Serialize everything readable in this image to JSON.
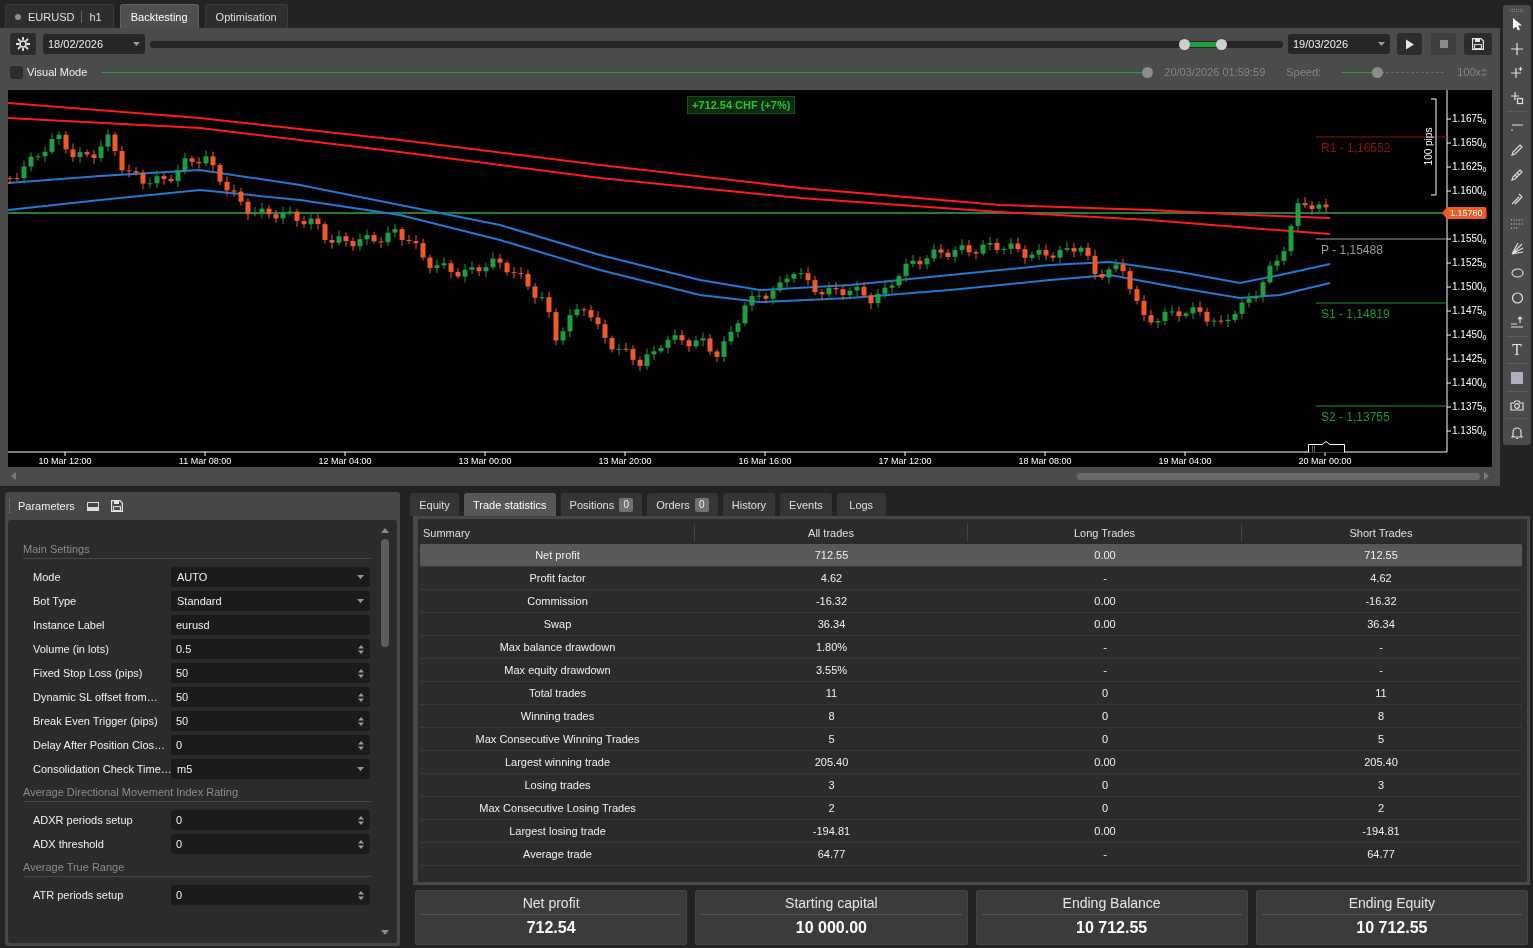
{
  "workspace_tabs": [
    {
      "kind": "symbol",
      "label": "EURUSD",
      "timeframe": "h1",
      "selected": false
    },
    {
      "kind": "mode",
      "label": "Backtesting",
      "selected": true
    },
    {
      "kind": "mode",
      "label": "Optimisation",
      "selected": false
    }
  ],
  "backtest_controls": {
    "start_date": "18/02/2026",
    "period_handles": [
      {
        "level": 0.913
      },
      {
        "level": 0.945
      }
    ],
    "end_date": "19/03/2026",
    "buttons": [
      {
        "kind": "play",
        "disabled": false
      },
      {
        "kind": "stop",
        "disabled": true
      },
      {
        "kind": "save",
        "disabled": false
      }
    ],
    "visual_mode": {
      "label": "Visual Mode",
      "checked": false
    },
    "progress": {
      "level": 1
    },
    "timestamp": "20/03/2026 01:59:59",
    "speed": {
      "label": "Speed:",
      "level": 0.33,
      "value": "100x"
    }
  },
  "chart": {
    "profit_badge": "+712.54 CHF (+7%)",
    "ruler_label": "100 pips",
    "price_labels": [
      "1.1675$_{0}$",
      "1.1650$_{0}$",
      "1.1625$_{0}$",
      "1.1600$_{0}$",
      "1.1550$_{0}$",
      "1.1525$_{0}$",
      "1.1500$_{0}$",
      "1.1475$_{0}$",
      "1.1450$_{0}$",
      "1.1425$_{0}$",
      "1.1400$_{0}$",
      "1.1375$_{0}$",
      "1.1350$_{0}$"
    ],
    "current_price": "1.15760",
    "pivots": [
      {
        "label": "R1 - 1,16552",
        "color": "#8b1414"
      },
      {
        "label": "P - 1,15488",
        "color": "#9a9a9a"
      },
      {
        "label": "S1 - 1,14819",
        "color": "#1d9a24"
      },
      {
        "label": "S2 - 1,13755",
        "color": "#1d9a24"
      }
    ],
    "time_labels": [
      "10 Mar 12:00",
      "11 Mar 08:00",
      "12 Mar 04:00",
      "13 Mar 00:00",
      "13 Mar 20:00",
      "16 Mar 16:00",
      "17 Mar 12:00",
      "18 Mar 08:00",
      "19 Mar 04:00",
      "20 Mar 00:00"
    ]
  },
  "drawing_toolbar": {
    "text_tool_label": "T"
  },
  "parameters": {
    "title": "Parameters",
    "groups": [
      {
        "title": "Main Settings",
        "rows": [
          {
            "label": "Mode",
            "kind": "select",
            "value": "AUTO"
          },
          {
            "label": "Bot Type",
            "kind": "select",
            "value": "Standard"
          },
          {
            "label": "Instance Label",
            "kind": "text",
            "value": "eurusd"
          },
          {
            "label": "Volume (in lots)",
            "kind": "number",
            "value": "0.5"
          },
          {
            "label": "Fixed Stop Loss (pips)",
            "kind": "number",
            "value": "50"
          },
          {
            "label": "Dynamic SL offset from…",
            "kind": "number",
            "value": "50"
          },
          {
            "label": "Break Even Trigger (pips)",
            "kind": "number",
            "value": "50"
          },
          {
            "label": "Delay After Position Clos…",
            "kind": "number",
            "value": "0"
          },
          {
            "label": "Consolidation Check Time…",
            "kind": "select",
            "value": "m5"
          }
        ]
      },
      {
        "title": "Average Directional Movement Index Rating",
        "rows": [
          {
            "label": "ADXR periods setup",
            "kind": "number",
            "value": "0"
          },
          {
            "label": "ADX threshold",
            "kind": "number",
            "value": "0"
          }
        ]
      },
      {
        "title": "Average True Range",
        "rows": [
          {
            "label": "ATR periods setup",
            "kind": "number",
            "value": "0"
          }
        ]
      }
    ]
  },
  "results": {
    "tabs": [
      {
        "label": "Equity",
        "selected": false
      },
      {
        "label": "Trade statistics",
        "selected": true
      },
      {
        "label": "Positions",
        "count": "0",
        "selected": false
      },
      {
        "label": "Orders",
        "count": "0",
        "selected": false
      },
      {
        "label": "History",
        "selected": false
      },
      {
        "label": "Events",
        "selected": false
      },
      {
        "label": "Logs",
        "selected": false
      }
    ],
    "table": {
      "columns": [
        "Summary",
        "All trades",
        "Long Trades",
        "Short Trades"
      ],
      "rows": [
        {
          "cells": [
            "Net profit",
            "712.55",
            "0.00",
            "712.55"
          ],
          "selected": true
        },
        {
          "cells": [
            "Profit factor",
            "4.62",
            "-",
            "4.62"
          ],
          "selected": false
        },
        {
          "cells": [
            "Commission",
            "-16.32",
            "0.00",
            "-16.32"
          ],
          "selected": false
        },
        {
          "cells": [
            "Swap",
            "36.34",
            "0.00",
            "36.34"
          ],
          "selected": false
        },
        {
          "cells": [
            "Max balance drawdown",
            "1.80%",
            "-",
            "-"
          ],
          "selected": false
        },
        {
          "cells": [
            "Max equity drawdown",
            "3.55%",
            "-",
            "-"
          ],
          "selected": false
        },
        {
          "cells": [
            "Total trades",
            "11",
            "0",
            "11"
          ],
          "selected": false
        },
        {
          "cells": [
            "Winning trades",
            "8",
            "0",
            "8"
          ],
          "selected": false
        },
        {
          "cells": [
            "Max Consecutive Winning Trades",
            "5",
            "0",
            "5"
          ],
          "selected": false
        },
        {
          "cells": [
            "Largest winning trade",
            "205.40",
            "0.00",
            "205.40"
          ],
          "selected": false
        },
        {
          "cells": [
            "Losing trades",
            "3",
            "0",
            "3"
          ],
          "selected": false
        },
        {
          "cells": [
            "Max Consecutive Losing Trades",
            "2",
            "0",
            "2"
          ],
          "selected": false
        },
        {
          "cells": [
            "Largest losing trade",
            "-194.81",
            "0.00",
            "-194.81"
          ],
          "selected": false
        },
        {
          "cells": [
            "Average trade",
            "64.77",
            "-",
            "64.77"
          ],
          "selected": false
        }
      ]
    },
    "summary_cards": [
      {
        "label": "Net profit",
        "value": "712.54"
      },
      {
        "label": "Starting capital",
        "value": "10 000.00"
      },
      {
        "label": "Ending Balance",
        "value": "10 712.55"
      },
      {
        "label": "Ending Equity",
        "value": "10 712.55"
      }
    ]
  }
}
